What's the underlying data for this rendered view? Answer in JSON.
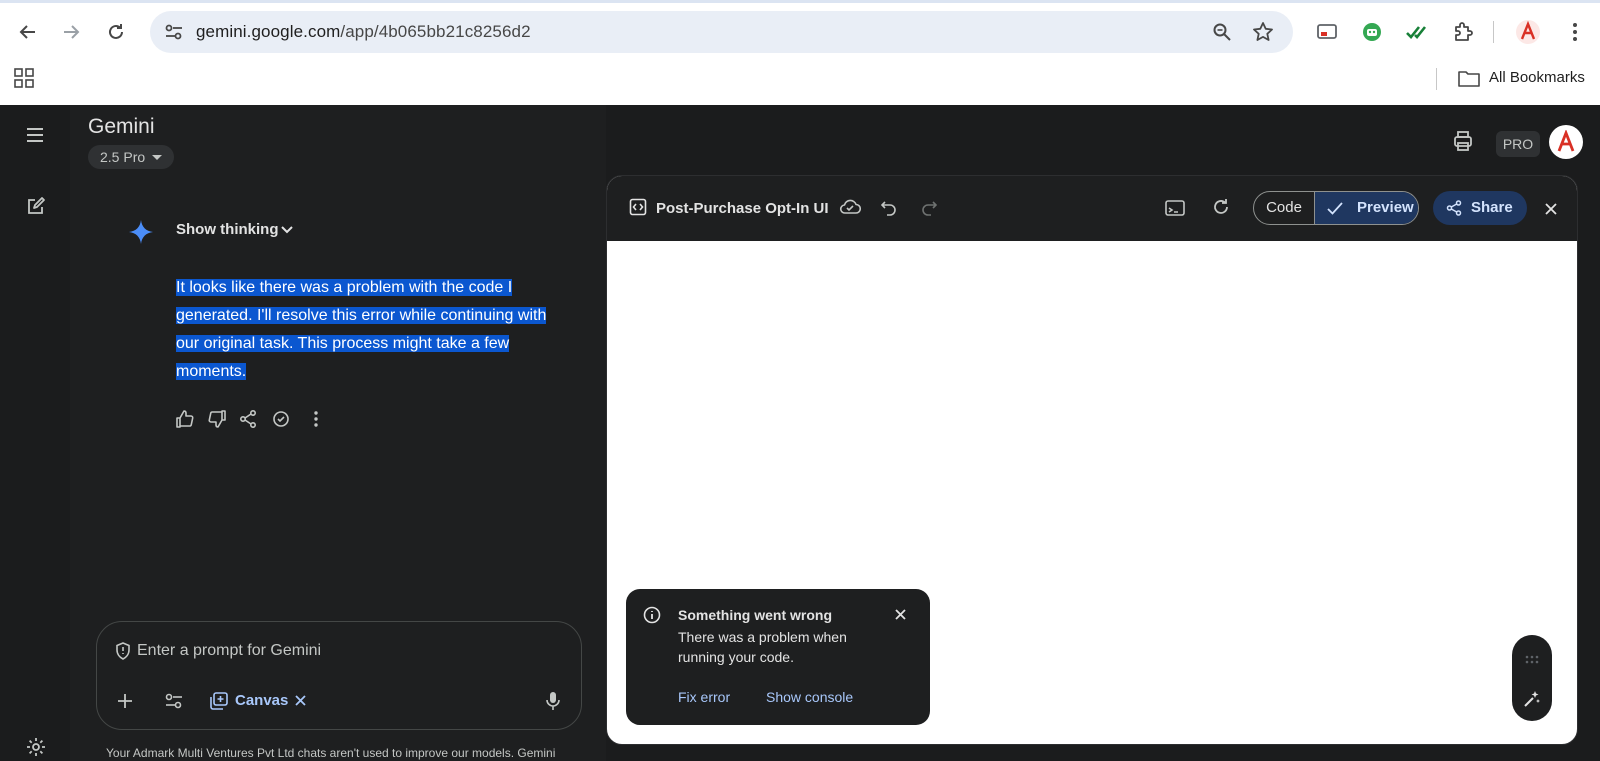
{
  "browser": {
    "url_host": "gemini.google.com",
    "url_path": "/app/4b065bb21c8256d2",
    "bookmarks_label": "All Bookmarks"
  },
  "app": {
    "title": "Gemini",
    "model": "2.5 Pro",
    "pro_badge": "PRO",
    "avatar_letter": "A"
  },
  "chat": {
    "show_thinking": "Show thinking",
    "response": "It looks like there was a problem with the code I generated. I'll resolve this error while continuing with our original task. This process might take a few moments.",
    "prompt_placeholder": "Enter a prompt for Gemini",
    "canvas_chip": "Canvas",
    "disclaimer": "Your Admark Multi Ventures Pvt Ltd chats aren't used to improve our models. Gemini"
  },
  "canvas": {
    "title": "Post-Purchase Opt-In UI",
    "code_label": "Code",
    "preview_label": "Preview",
    "share_label": "Share"
  },
  "toast": {
    "title": "Something went wrong",
    "body": "There was a problem when running your code.",
    "fix_error": "Fix error",
    "show_console": "Show console"
  },
  "colors": {
    "accent": "#a8c7fa",
    "selection": "#0b57d0",
    "panel_dark": "#1e1f20"
  }
}
